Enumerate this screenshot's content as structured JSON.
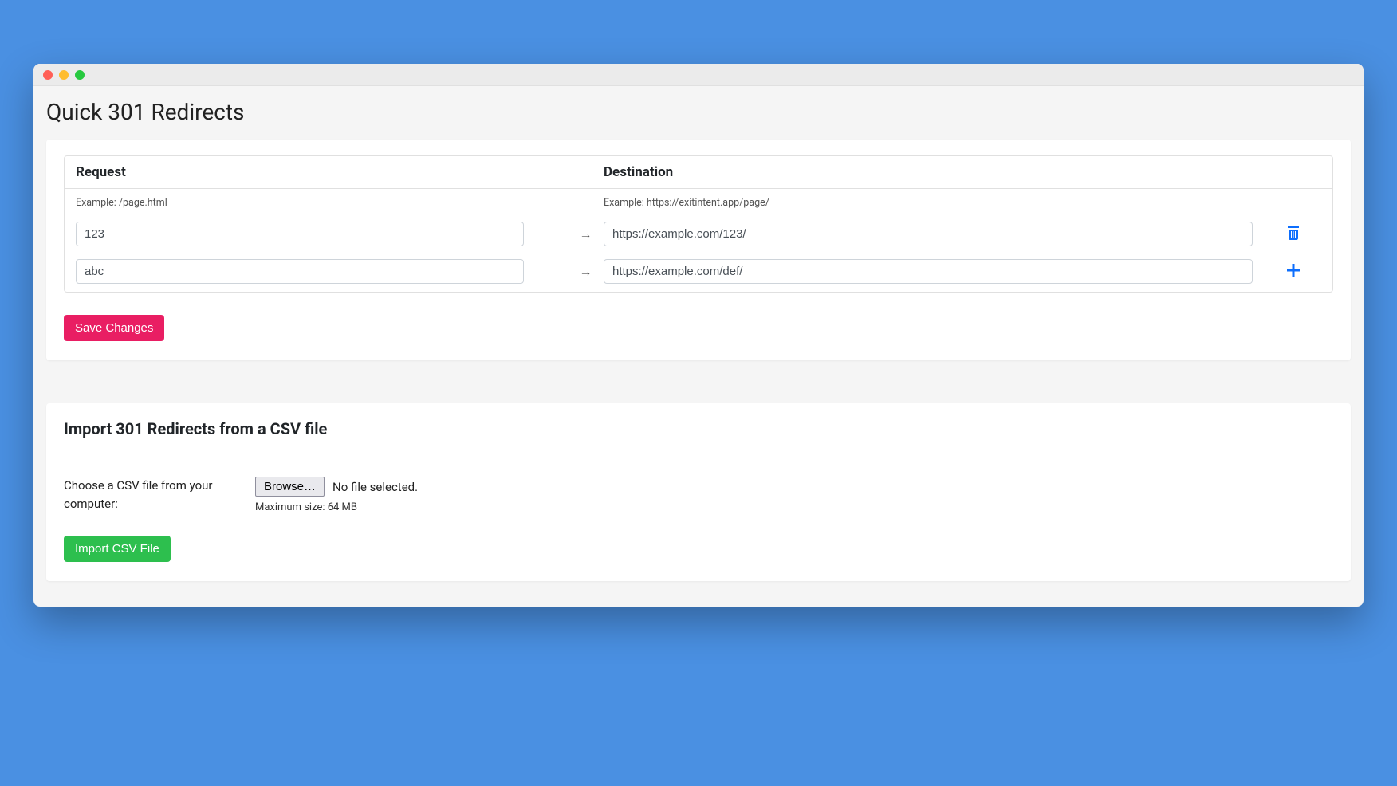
{
  "page": {
    "title": "Quick 301 Redirects"
  },
  "table": {
    "header_request": "Request",
    "header_destination": "Destination",
    "example_request": "Example: /page.html",
    "example_destination": "Example: https://exitintent.app/page/",
    "arrow": "→"
  },
  "redirects": [
    {
      "request": "123",
      "destination": "https://example.com/123/",
      "action": "delete"
    },
    {
      "request": "abc",
      "destination": "https://example.com/def/",
      "action": "add"
    }
  ],
  "buttons": {
    "save": "Save Changes",
    "import": "Import CSV File"
  },
  "import_section": {
    "title": "Import 301 Redirects from a CSV file",
    "label": "Choose a CSV file from your computer:",
    "browse": "Browse…",
    "no_file": "No file selected.",
    "max_size": "Maximum size: 64 MB"
  }
}
